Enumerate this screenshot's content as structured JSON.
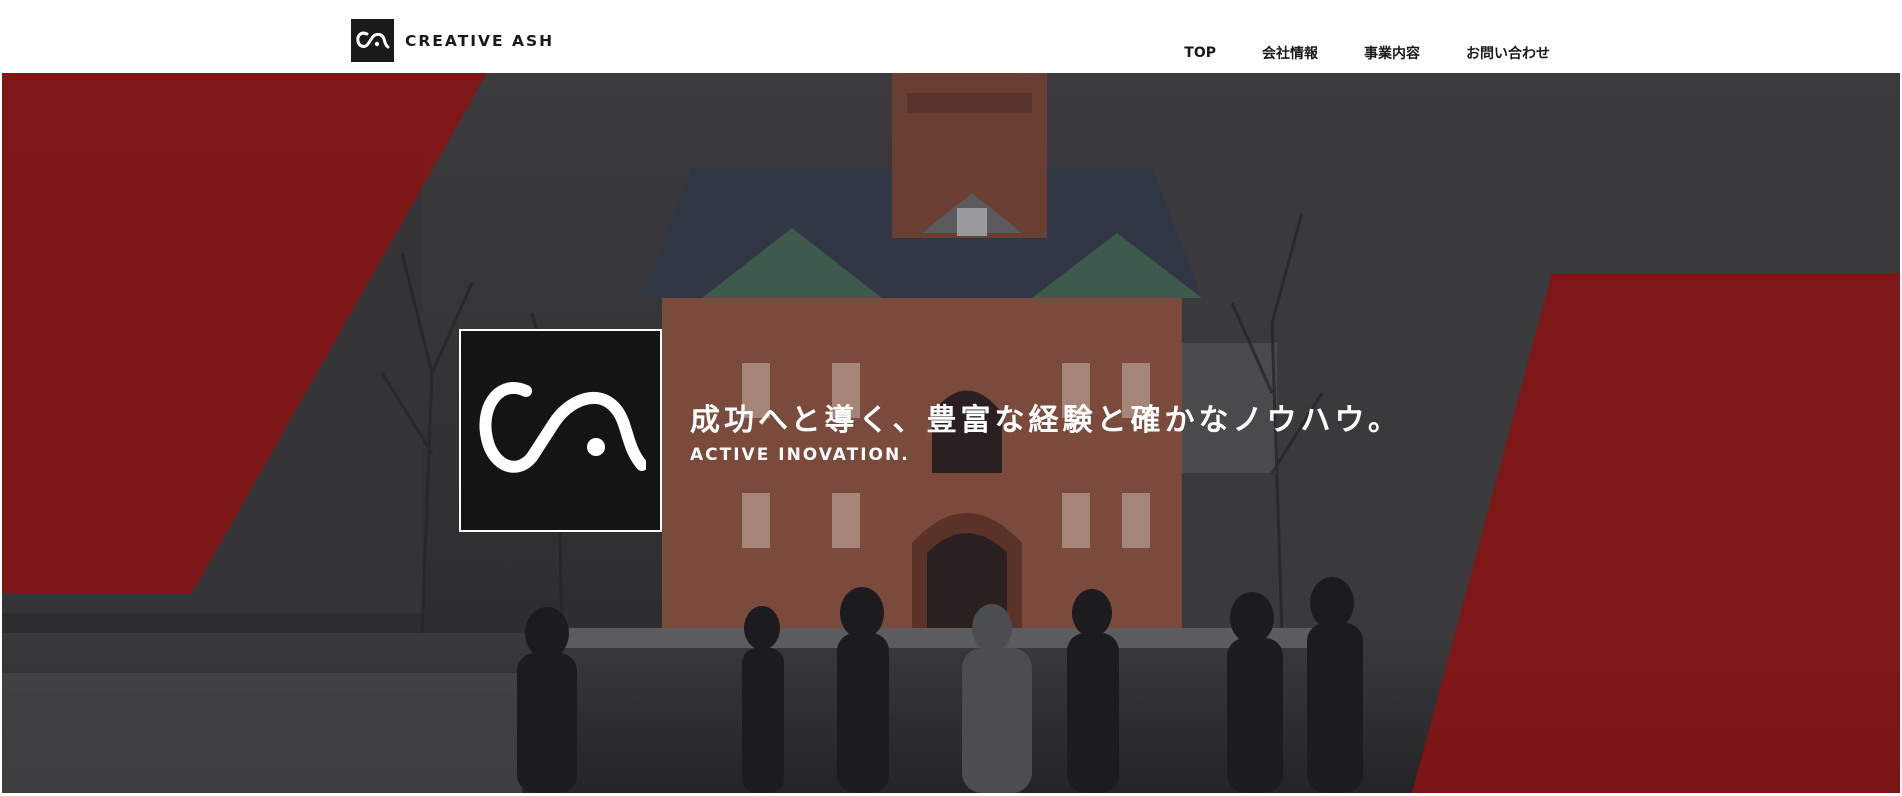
{
  "header": {
    "brand": "CREATIVE ASH",
    "logo_icon": "ca-logo-icon"
  },
  "nav": {
    "items": [
      {
        "label": "TOP"
      },
      {
        "label": "会社情報"
      },
      {
        "label": "事業内容"
      },
      {
        "label": "お問い合わせ"
      }
    ]
  },
  "hero": {
    "tagline": "成功へと導く、豊富な経験と確かなノウハウ。",
    "subline": "ACTIVE INOVATION.",
    "emblem_icon": "ca-emblem-icon",
    "background_image": "street-scene-with-red-brick-building",
    "colors": {
      "accent_red": "#8b1212",
      "overlay_dark": "#2f2f31"
    }
  }
}
